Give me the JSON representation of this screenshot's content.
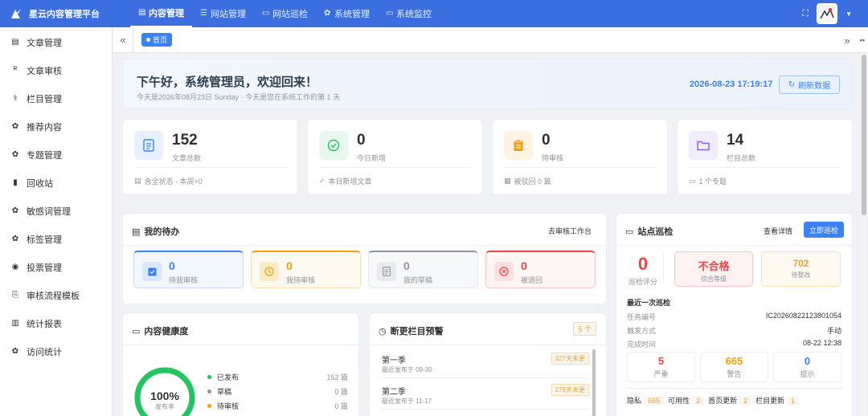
{
  "app": {
    "title": "星云内容管理平台"
  },
  "topnav": [
    {
      "label": "内容管理",
      "icon": "document-icon",
      "active": true
    },
    {
      "label": "网站管理",
      "icon": "list-icon",
      "active": false
    },
    {
      "label": "网站巡检",
      "icon": "monitor-icon",
      "active": false
    },
    {
      "label": "系统管理",
      "icon": "gear-icon",
      "active": false
    },
    {
      "label": "系统监控",
      "icon": "monitor-icon",
      "active": false
    }
  ],
  "sidebar": {
    "items": [
      {
        "label": "文章管理",
        "icon": "document-icon"
      },
      {
        "label": "文章审核",
        "icon": "user-icon"
      },
      {
        "label": "栏目管理",
        "icon": "tree-icon"
      },
      {
        "label": "推荐内容",
        "icon": "gear-icon"
      },
      {
        "label": "专题管理",
        "icon": "gear-icon"
      },
      {
        "label": "回收站",
        "icon": "trash-icon"
      },
      {
        "label": "敏感词管理",
        "icon": "gear-icon"
      },
      {
        "label": "标签管理",
        "icon": "gear-icon"
      },
      {
        "label": "投票管理",
        "icon": "target-icon"
      },
      {
        "label": "审核流程模板",
        "icon": "flow-icon"
      },
      {
        "label": "统计报表",
        "icon": "bar-chart-icon"
      },
      {
        "label": "访问统计",
        "icon": "gear-icon"
      }
    ]
  },
  "tabs": {
    "home": "首页"
  },
  "welcome": {
    "title": "下午好，系统管理员，欢迎回来！",
    "subtitle": "今天是2026年08月23日 Sunday · 今天是您在系统工作的第 1 天",
    "clock": "2026-08-23 17:19:17",
    "refresh_label": "刷新数据"
  },
  "stats": [
    {
      "value": "152",
      "label": "文章总数",
      "foot": "含全状态 · 本周+0",
      "color": "#3b82f6",
      "bg": "#e8f0fe",
      "icon": "document-icon",
      "foot_icon": "document-icon"
    },
    {
      "value": "0",
      "label": "今日新增",
      "foot": "本日新增文章",
      "color": "#22c55e",
      "bg": "#e7f8ee",
      "icon": "check-circle-icon",
      "foot_icon": "check-circle-icon"
    },
    {
      "value": "0",
      "label": "待审核",
      "foot": "被驳回 0 篇",
      "color": "#f59e0b",
      "bg": "#fef3e2",
      "icon": "clipboard-icon",
      "foot_icon": "trash-icon"
    },
    {
      "value": "14",
      "label": "栏目总数",
      "foot": "1 个专题",
      "color": "#8b5cf6",
      "bg": "#f1ecfe",
      "icon": "folder-icon",
      "foot_icon": "folder-icon"
    }
  ],
  "todo": {
    "title": "我的待办",
    "link": "去审核工作台",
    "items": [
      {
        "value": "0",
        "label": "待我审核",
        "color": "#3b82f6",
        "bg": "#f3f7fe",
        "border": "#c9dbf8"
      },
      {
        "value": "0",
        "label": "我待审核",
        "color": "#f59e0b",
        "bg": "#fefaf2",
        "border": "#f7dfb5"
      },
      {
        "value": "0",
        "label": "我的草稿",
        "color": "#909399",
        "bg": "#f7f8fa",
        "border": "#e4e7ed"
      },
      {
        "value": "0",
        "label": "被退回",
        "color": "#ef4444",
        "bg": "#fef5f5",
        "border": "#f9caca"
      }
    ]
  },
  "inspection": {
    "title": "站点巡检",
    "detail_link": "查看详情",
    "run_button": "立即巡检",
    "score": "0",
    "score_label": "巡检评分",
    "grade": "不合格",
    "grade_label": "综合等级",
    "pending": "702",
    "pending_label": "待整改",
    "last_title": "最近一次巡检",
    "fields": [
      {
        "k": "任务编号",
        "v": "IC20260822123801054"
      },
      {
        "k": "触发方式",
        "v": "手动"
      },
      {
        "k": "完成时间",
        "v": "08-22 12:38"
      }
    ],
    "severity": [
      {
        "value": "5",
        "label": "严重",
        "color": "#ef4444"
      },
      {
        "value": "665",
        "label": "警告",
        "color": "#f59e0b"
      },
      {
        "value": "0",
        "label": "提示",
        "color": "#3b82f6"
      }
    ],
    "categories": [
      {
        "label": "隐私",
        "count": "665"
      },
      {
        "label": "可用性",
        "count": "2"
      },
      {
        "label": "首页更新",
        "count": "2"
      },
      {
        "label": "栏目更新",
        "count": "1"
      }
    ]
  },
  "health": {
    "title": "内容健康度",
    "percent": "100%",
    "percent_label": "发布率",
    "percent_value": 1.0,
    "legend": [
      {
        "label": "已发布",
        "count": "152 篇",
        "color": "#22c55e"
      },
      {
        "label": "草稿",
        "count": "0 篇",
        "color": "#909399"
      },
      {
        "label": "待审核",
        "count": "0 篇",
        "color": "#f59e0b"
      }
    ]
  },
  "alerts": {
    "title": "断更栏目预警",
    "count": "5 个",
    "items": [
      {
        "name": "第一季",
        "date": "最近发布于 09-30",
        "tag": "327天未更"
      },
      {
        "name": "第二季",
        "date": "最近发布于 11-17",
        "tag": "279天未更"
      }
    ]
  }
}
